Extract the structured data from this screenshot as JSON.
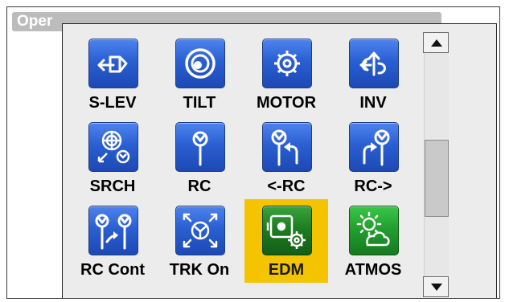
{
  "window": {
    "title": "Oper"
  },
  "menu": {
    "items": [
      {
        "label": "S-LEV",
        "icon": "s-lev-icon"
      },
      {
        "label": "TILT",
        "icon": "tilt-icon"
      },
      {
        "label": "MOTOR",
        "icon": "motor-gear-icon"
      },
      {
        "label": "INV",
        "icon": "invert-icon"
      },
      {
        "label": "SRCH",
        "icon": "search-prism-icon"
      },
      {
        "label": "RC",
        "icon": "remote-control-icon"
      },
      {
        "label": "<-RC",
        "icon": "rc-left-icon"
      },
      {
        "label": "RC->",
        "icon": "rc-right-icon"
      },
      {
        "label": "RC Cont",
        "icon": "rc-continuous-icon"
      },
      {
        "label": "TRK On",
        "icon": "tracking-icon"
      },
      {
        "label": "EDM",
        "icon": "edm-settings-icon",
        "selected": true
      },
      {
        "label": "ATMOS",
        "icon": "atmosphere-icon"
      }
    ]
  },
  "scrollbar": {
    "up": "scroll-up-arrow",
    "down": "scroll-down-arrow"
  },
  "colors": {
    "icon_blue": "#2a5fd2",
    "icon_green": "#22a02f",
    "selection": "#f5c400",
    "title_bar": "#bcbcbc"
  }
}
